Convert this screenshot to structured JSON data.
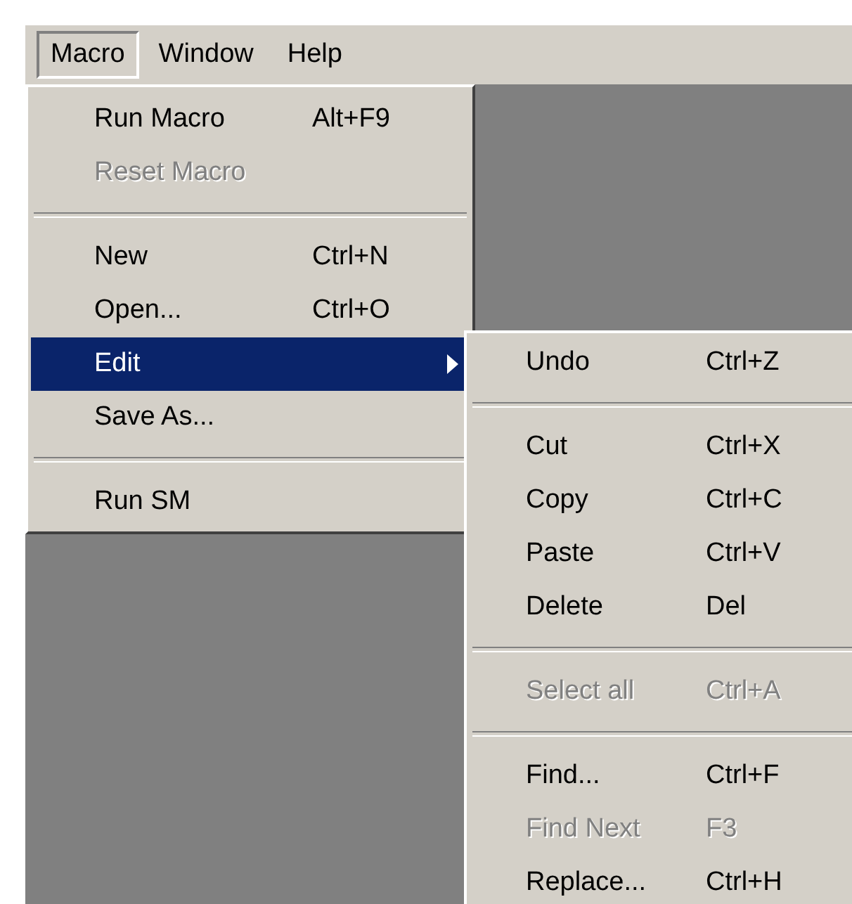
{
  "menubar": [
    {
      "label": "Macro",
      "selected": true
    },
    {
      "label": "Window",
      "selected": false
    },
    {
      "label": "Help",
      "selected": false
    }
  ],
  "menu": {
    "items": [
      {
        "kind": "item",
        "label": "Run Macro",
        "shortcut": "Alt+F9",
        "disabled": false,
        "selected": false,
        "has_submenu": false
      },
      {
        "kind": "item",
        "label": "Reset Macro",
        "disabled": true,
        "selected": false,
        "has_submenu": false
      },
      {
        "kind": "separator"
      },
      {
        "kind": "item",
        "label": "New",
        "shortcut": "Ctrl+N",
        "disabled": false,
        "selected": false,
        "has_submenu": false
      },
      {
        "kind": "item",
        "label": "Open...",
        "shortcut": "Ctrl+O",
        "disabled": false,
        "selected": false,
        "has_submenu": false
      },
      {
        "kind": "item",
        "label": "Edit",
        "disabled": false,
        "selected": true,
        "has_submenu": true
      },
      {
        "kind": "item",
        "label": "Save As...",
        "disabled": false,
        "selected": false,
        "has_submenu": false
      },
      {
        "kind": "separator"
      },
      {
        "kind": "item",
        "label": "Run SM",
        "disabled": false,
        "selected": false,
        "has_submenu": false
      }
    ]
  },
  "submenu": {
    "items": [
      {
        "kind": "item",
        "label": "Undo",
        "shortcut": "Ctrl+Z",
        "disabled": false
      },
      {
        "kind": "separator"
      },
      {
        "kind": "item",
        "label": "Cut",
        "shortcut": "Ctrl+X",
        "disabled": false
      },
      {
        "kind": "item",
        "label": "Copy",
        "shortcut": "Ctrl+C",
        "disabled": false
      },
      {
        "kind": "item",
        "label": "Paste",
        "shortcut": "Ctrl+V",
        "disabled": false
      },
      {
        "kind": "item",
        "label": "Delete",
        "shortcut": "Del",
        "disabled": false
      },
      {
        "kind": "separator"
      },
      {
        "kind": "item",
        "label": "Select all",
        "shortcut": "Ctrl+A",
        "disabled": true
      },
      {
        "kind": "separator"
      },
      {
        "kind": "item",
        "label": "Find...",
        "shortcut": "Ctrl+F",
        "disabled": false
      },
      {
        "kind": "item",
        "label": "Find Next",
        "shortcut": "F3",
        "disabled": true
      },
      {
        "kind": "item",
        "label": "Replace...",
        "shortcut": "Ctrl+H",
        "disabled": false
      }
    ]
  }
}
